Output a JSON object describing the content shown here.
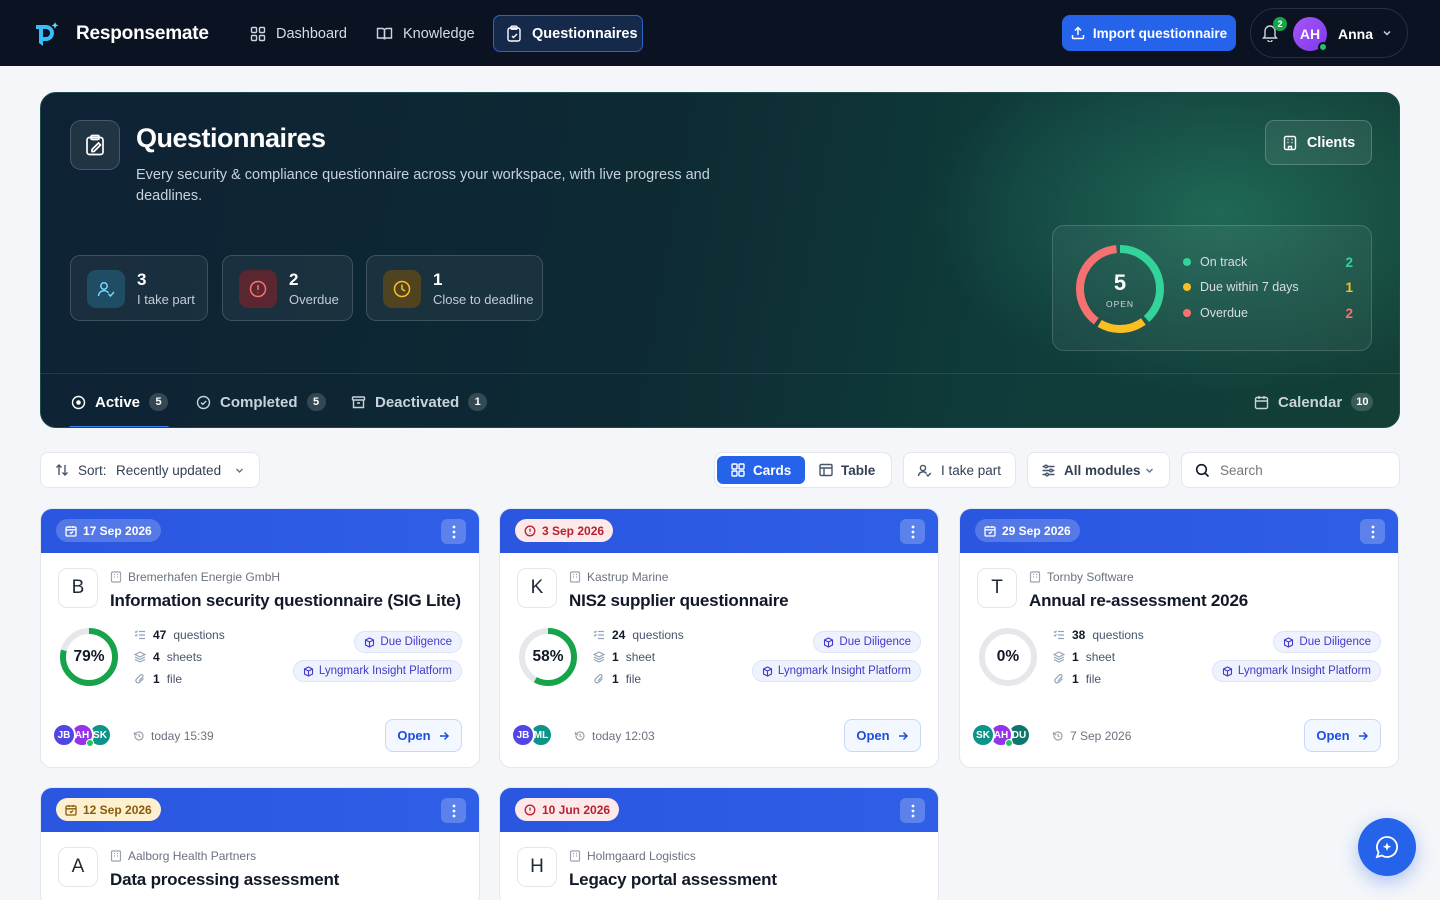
{
  "app": {
    "brand": "Responsemate",
    "nav": [
      {
        "label": "Dashboard",
        "icon": "grid-icon"
      },
      {
        "label": "Knowledge",
        "icon": "book-icon"
      },
      {
        "label": "Questionnaires",
        "icon": "clipboard-icon",
        "active": true
      }
    ],
    "import_label": "Import questionnaire",
    "notifications_count": "2",
    "user": {
      "initials": "AH",
      "name": "Anna"
    }
  },
  "hero": {
    "title": "Questionnaires",
    "subtitle": "Every security & compliance questionnaire across your workspace, with live progress and deadlines.",
    "clients_label": "Clients",
    "stats": [
      {
        "value": "3",
        "label": "I take part",
        "icon": "user-check-icon"
      },
      {
        "value": "2",
        "label": "Overdue",
        "icon": "alert-circle-icon"
      },
      {
        "value": "1",
        "label": "Close to deadline",
        "icon": "clock-icon"
      }
    ],
    "summary": {
      "total": "5",
      "total_label": "OPEN",
      "legend": [
        {
          "label": "On track",
          "value": "2",
          "color": "#34d399"
        },
        {
          "label": "Due within 7 days",
          "value": "1",
          "color": "#fbbf24"
        },
        {
          "label": "Overdue",
          "value": "2",
          "color": "#f87171"
        }
      ]
    },
    "tabs": [
      {
        "label": "Active",
        "count": "5",
        "icon": "circle-dot-icon",
        "active": true
      },
      {
        "label": "Completed",
        "count": "5",
        "icon": "check-circle-icon"
      },
      {
        "label": "Deactivated",
        "count": "1",
        "icon": "archive-icon"
      }
    ],
    "calendar": {
      "label": "Calendar",
      "count": "10"
    }
  },
  "toolbar": {
    "sort_prefix": "Sort:",
    "sort_value": "Recently updated",
    "view_cards": "Cards",
    "view_table": "Table",
    "filter_part": "I take part",
    "filter_modules": "All modules",
    "search_placeholder": "Search"
  },
  "cards": [
    {
      "date": "17 Sep 2026",
      "date_state": "normal",
      "letter": "B",
      "org": "Bremerhafen Energie GmbH",
      "title": "Information security questionnaire (SIG Lite)",
      "progress": "79%",
      "progress_fraction": 0.79,
      "ring_color": "#16a34a",
      "questions": "47",
      "questions_label": "questions",
      "sheets": "4",
      "sheets_label": "sheets",
      "files": "1",
      "files_label": "file",
      "module": "Due Diligence",
      "platform": "Lyngmark Insight Platform",
      "avatars": [
        {
          "i": "JB",
          "c": "#4f46e5"
        },
        {
          "i": "AH",
          "c": "#9333ea",
          "online": true
        },
        {
          "i": "SK",
          "c": "#0d9488"
        }
      ],
      "updated": "today 15:39",
      "open_label": "Open"
    },
    {
      "date": "3 Sep 2026",
      "date_state": "danger",
      "letter": "K",
      "org": "Kastrup Marine",
      "title": "NIS2 supplier questionnaire",
      "progress": "58%",
      "progress_fraction": 0.58,
      "ring_color": "#16a34a",
      "questions": "24",
      "questions_label": "questions",
      "sheets": "1",
      "sheets_label": "sheet",
      "files": "1",
      "files_label": "file",
      "module": "Due Diligence",
      "platform": "Lyngmark Insight Platform",
      "avatars": [
        {
          "i": "JB",
          "c": "#4f46e5"
        },
        {
          "i": "ML",
          "c": "#0d9488"
        }
      ],
      "updated": "today 12:03",
      "open_label": "Open"
    },
    {
      "date": "29 Sep 2026",
      "date_state": "normal",
      "letter": "T",
      "org": "Tornby Software",
      "title": "Annual re-assessment 2026",
      "progress": "0%",
      "progress_fraction": 0,
      "ring_color": "#16a34a",
      "questions": "38",
      "questions_label": "questions",
      "sheets": "1",
      "sheets_label": "sheet",
      "files": "1",
      "files_label": "file",
      "module": "Due Diligence",
      "platform": "Lyngmark Insight Platform",
      "avatars": [
        {
          "i": "SK",
          "c": "#0d9488"
        },
        {
          "i": "AH",
          "c": "#9333ea",
          "online": true
        },
        {
          "i": "DU",
          "c": "#0f766e"
        }
      ],
      "updated": "7 Sep 2026",
      "open_label": "Open"
    },
    {
      "date": "12 Sep 2026",
      "date_state": "warn",
      "letter": "A",
      "org": "Aalborg Health Partners",
      "title": "Data processing assessment"
    },
    {
      "date": "10 Jun 2026",
      "date_state": "danger",
      "letter": "H",
      "org": "Holmgaard Logistics",
      "title": "Legacy portal assessment"
    }
  ]
}
